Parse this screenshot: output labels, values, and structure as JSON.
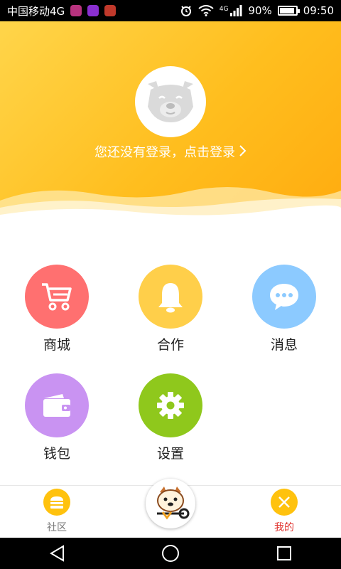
{
  "status_bar": {
    "carrier": "中国移动4G",
    "network": "4G",
    "battery": "90%",
    "battery_level": 0.9,
    "time": "09:50"
  },
  "header": {
    "login_prompt": "您还没有登录，点击登录",
    "gradient_start": "#ffd54a",
    "gradient_end": "#ffab0f"
  },
  "grid": {
    "items": [
      {
        "label": "商城",
        "icon": "shopping-cart-icon",
        "color": "#ff7070"
      },
      {
        "label": "合作",
        "icon": "bell-icon",
        "color": "#ffcf4a"
      },
      {
        "label": "消息",
        "icon": "chat-bubble-icon",
        "color": "#8ccaff"
      },
      {
        "label": "钱包",
        "icon": "wallet-icon",
        "color": "#c993f2"
      },
      {
        "label": "设置",
        "icon": "gear-icon",
        "color": "#8fc81c"
      }
    ]
  },
  "bottom_nav": {
    "items": [
      {
        "label": "社区",
        "icon": "community-icon",
        "active": false
      },
      {
        "label": "我的",
        "icon": "close-icon",
        "active": true
      }
    ],
    "center_icon": "mascot-icon",
    "active_color": "#e0332f",
    "inactive_color": "#777777"
  },
  "android_nav": [
    "back-icon",
    "home-icon",
    "recents-icon"
  ]
}
